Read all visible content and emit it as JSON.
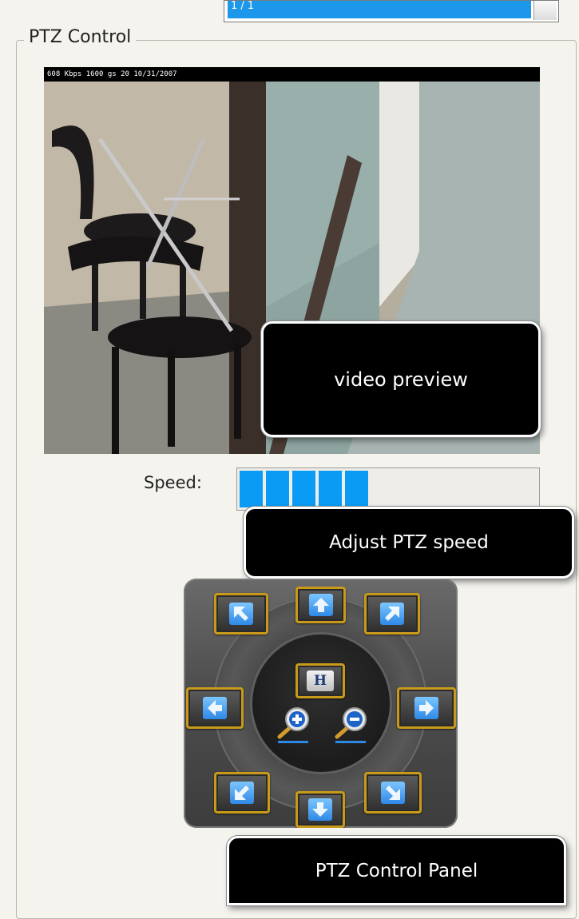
{
  "top_selector": {
    "value": "1 / 1"
  },
  "group": {
    "title": "PTZ Control"
  },
  "video": {
    "osd_text": "608 Kbps  1600 gs 20   10/31/2007",
    "callout": "video preview"
  },
  "speed": {
    "label": "Speed:",
    "level": 5,
    "max": 12,
    "callout": "Adjust PTZ speed"
  },
  "ptz_panel": {
    "home_label": "H",
    "callout": "PTZ Control Panel"
  },
  "colors": {
    "accent_blue": "#0a9bf5",
    "button_border_gold": "#c99a1a",
    "callout_bg": "#000000"
  }
}
